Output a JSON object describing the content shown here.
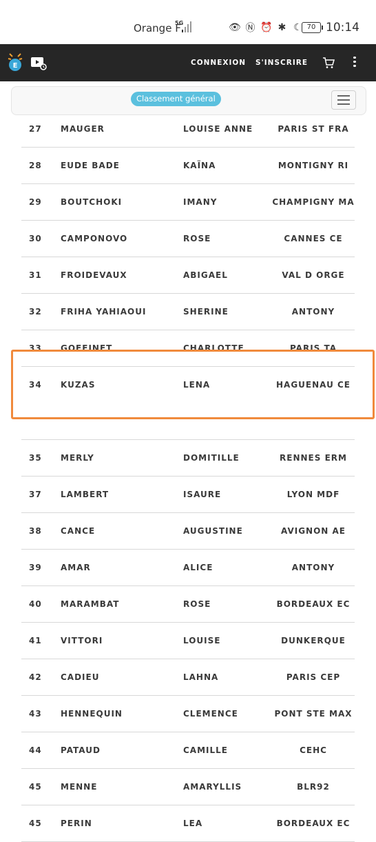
{
  "status_bar": {
    "carrier": "Orange F",
    "network": "5G",
    "battery": "70",
    "time": "10:14",
    "icons": [
      "eye-icon",
      "nfc-icon",
      "alarm-icon",
      "bluetooth-icon",
      "moon-icon"
    ]
  },
  "app_bar": {
    "login_label": "CONNEXION",
    "signup_label": "S'INSCRIRE"
  },
  "filter_bar": {
    "selected_filter": "Classement général"
  },
  "table": {
    "rows": [
      {
        "rank": "27",
        "last": "MAUGER",
        "first": "LOUISE ANNE",
        "club": "PARIS ST FRA"
      },
      {
        "rank": "28",
        "last": "EUDE BADE",
        "first": "KAÏNA",
        "club": "MONTIGNY RI"
      },
      {
        "rank": "29",
        "last": "BOUTCHOKI",
        "first": "IMANY",
        "club": "CHAMPIGNY MA"
      },
      {
        "rank": "30",
        "last": "CAMPONOVO",
        "first": "ROSE",
        "club": "CANNES CE"
      },
      {
        "rank": "31",
        "last": "FROIDEVAUX",
        "first": "ABIGAEL",
        "club": "VAL D ORGE"
      },
      {
        "rank": "32",
        "last": "FRIHA YAHIAOUI",
        "first": "SHERINE",
        "club": "ANTONY"
      },
      {
        "rank": "33",
        "last": "GOFFINET",
        "first": "CHARLOTTE",
        "club": "PARIS TA"
      },
      {
        "rank": "34",
        "last": "KUZAS",
        "first": "LENA",
        "club": "HAGUENAU CE"
      },
      {
        "rank": "",
        "last": "",
        "first": "",
        "club": ""
      },
      {
        "rank": "35",
        "last": "MERLY",
        "first": "DOMITILLE",
        "club": "RENNES ERM"
      },
      {
        "rank": "37",
        "last": "LAMBERT",
        "first": "ISAURE",
        "club": "LYON MDF"
      },
      {
        "rank": "38",
        "last": "CANCE",
        "first": "AUGUSTINE",
        "club": "AVIGNON AE"
      },
      {
        "rank": "39",
        "last": "AMAR",
        "first": "ALICE",
        "club": "ANTONY"
      },
      {
        "rank": "40",
        "last": "MARAMBAT",
        "first": "ROSE",
        "club": "BORDEAUX EC"
      },
      {
        "rank": "41",
        "last": "VITTORI",
        "first": "LOUISE",
        "club": "DUNKERQUE"
      },
      {
        "rank": "42",
        "last": "CADIEU",
        "first": "LAHNA",
        "club": "PARIS CEP"
      },
      {
        "rank": "43",
        "last": "HENNEQUIN",
        "first": "CLEMENCE",
        "club": "PONT STE MAX"
      },
      {
        "rank": "44",
        "last": "PATAUD",
        "first": "CAMILLE",
        "club": "CEHC"
      },
      {
        "rank": "45",
        "last": "MENNE",
        "first": "AMARYLLIS",
        "club": "BLR92"
      },
      {
        "rank": "45",
        "last": "PERIN",
        "first": "LEA",
        "club": "BORDEAUX EC"
      }
    ]
  },
  "highlight_color": "#f08a3c",
  "accent_color": "#5bc0de"
}
